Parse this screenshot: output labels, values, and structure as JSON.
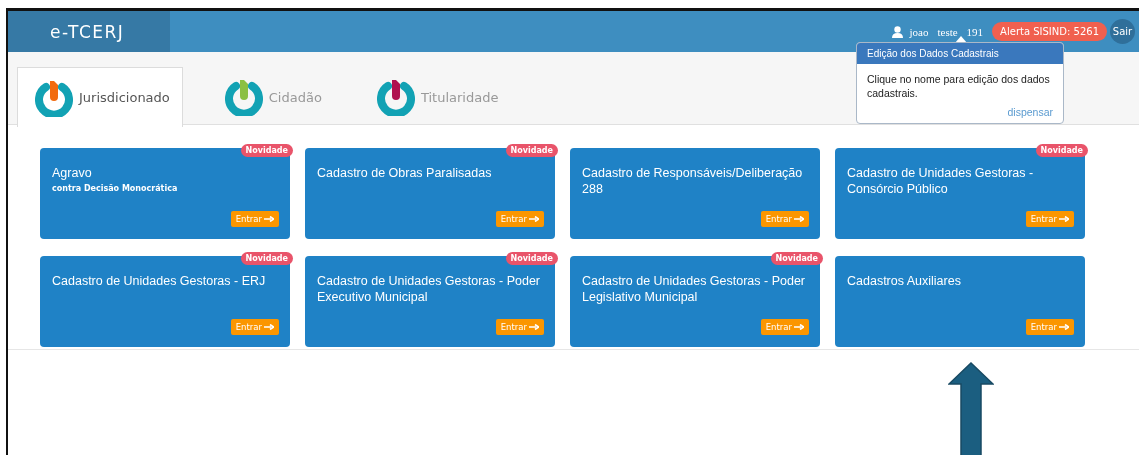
{
  "header": {
    "logo": "e-TCERJ",
    "user_first": "joao",
    "user_last": "teste",
    "count": "191",
    "alert": "Alerta SISIND: 5261",
    "logout": "Sair"
  },
  "popover": {
    "title": "Edição dos Dados Cadastrais",
    "body": "Clique no nome para edição dos dados cadastrais.",
    "dismiss": "dispensar"
  },
  "tabs": [
    {
      "label": "Jurisdicionado",
      "selected": true,
      "color": "#f26b0f"
    },
    {
      "label": "Cidadão",
      "selected": false,
      "color": "#8bc043"
    },
    {
      "label": "Titularidade",
      "selected": false,
      "color": "#b0114f"
    }
  ],
  "cards": [
    {
      "title": "Agravo",
      "subtitle": "contra Decisão Monocrática",
      "badge": "Novidade",
      "button": "Entrar"
    },
    {
      "title": "Cadastro de Obras Paralisadas",
      "badge": "Novidade",
      "button": "Entrar"
    },
    {
      "title": "Cadastro de Responsáveis/Deliberação 288",
      "button": "Entrar"
    },
    {
      "title": "Cadastro de Unidades Gestoras - Consórcio Público",
      "badge": "Novidade",
      "button": "Entrar"
    },
    {
      "title": "Cadastro de Unidades Gestoras - ERJ",
      "badge": "Novidade",
      "button": "Entrar"
    },
    {
      "title": "Cadastro de Unidades Gestoras - Poder Executivo Municipal",
      "badge": "Novidade",
      "button": "Entrar"
    },
    {
      "title": "Cadastro de Unidades Gestoras - Poder Legislativo Municipal",
      "badge": "Novidade",
      "button": "Entrar"
    },
    {
      "title": "Cadastros Auxiliares",
      "button": "Entrar"
    }
  ]
}
